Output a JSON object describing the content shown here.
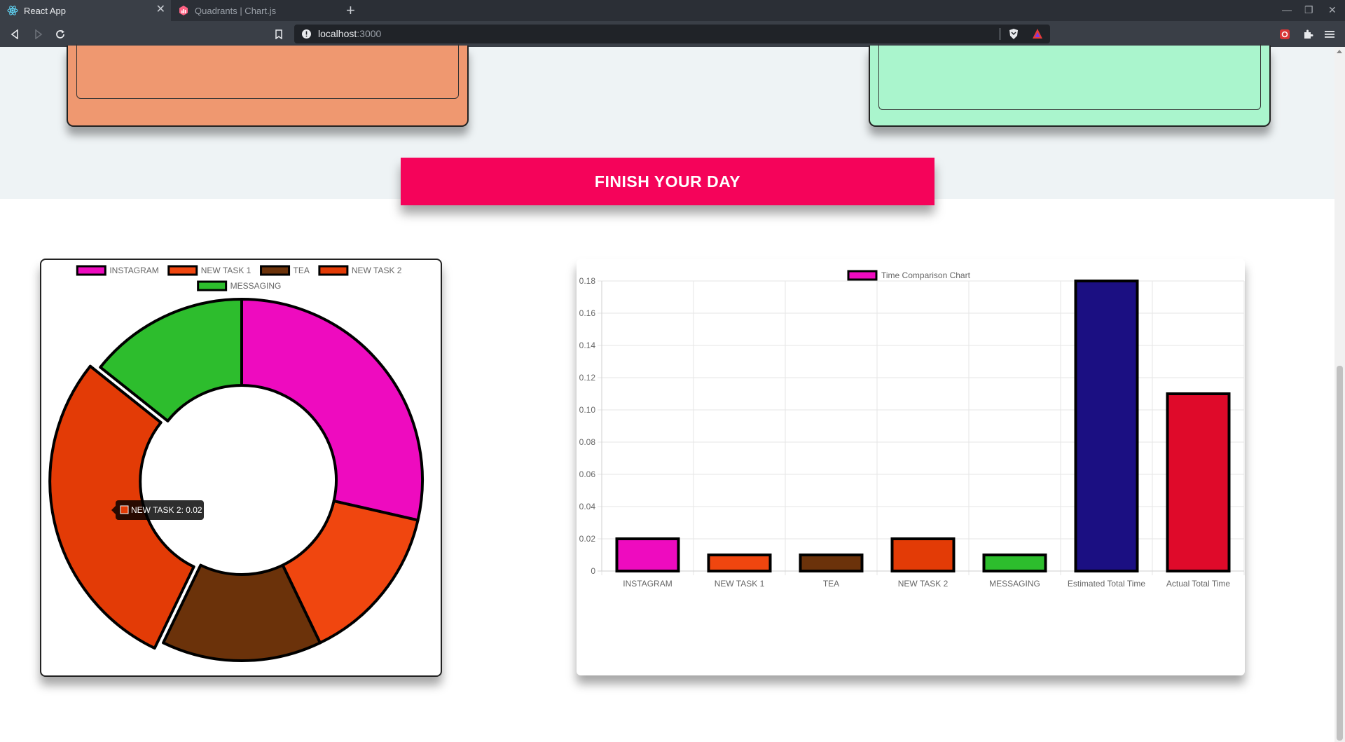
{
  "browser": {
    "tabs": [
      {
        "title": "React App",
        "active": true
      },
      {
        "title": "Quadrants | Chart.js",
        "active": false
      }
    ],
    "url_host": "localhost",
    "url_port": ":3000"
  },
  "page": {
    "finish_button_label": "FINISH YOUR DAY"
  },
  "colors": {
    "instagram": "#ee0bbf",
    "new_task_1": "#f0460f",
    "tea": "#6b320a",
    "new_task_2": "#e33b06",
    "messaging": "#2dbd2d",
    "estimated": "#1b0f82",
    "actual": "#df0a2a",
    "finish_button": "#f5035a"
  },
  "chart_data": [
    {
      "type": "doughnut",
      "legend": [
        "INSTAGRAM",
        "NEW TASK 1",
        "TEA",
        "NEW TASK 2",
        "MESSAGING"
      ],
      "values": [
        0.02,
        0.01,
        0.01,
        0.02,
        0.01
      ],
      "legend_position": "top",
      "tooltip": "NEW TASK 2: 0.02",
      "highlighted": "NEW TASK 2"
    },
    {
      "type": "bar",
      "legend": "Time Comparison Chart",
      "categories": [
        "INSTAGRAM",
        "NEW TASK 1",
        "TEA",
        "NEW TASK 2",
        "MESSAGING",
        "Estimated Total Time",
        "Actual Total Time"
      ],
      "values": [
        0.02,
        0.01,
        0.01,
        0.02,
        0.01,
        0.18,
        0.11
      ],
      "ylim": [
        0,
        0.18
      ],
      "yticks": [
        "0.18",
        "0.16",
        "0.14",
        "0.12",
        "0.10",
        "0.08",
        "0.06",
        "0.04",
        "0.02",
        "0"
      ],
      "grid": true
    }
  ]
}
